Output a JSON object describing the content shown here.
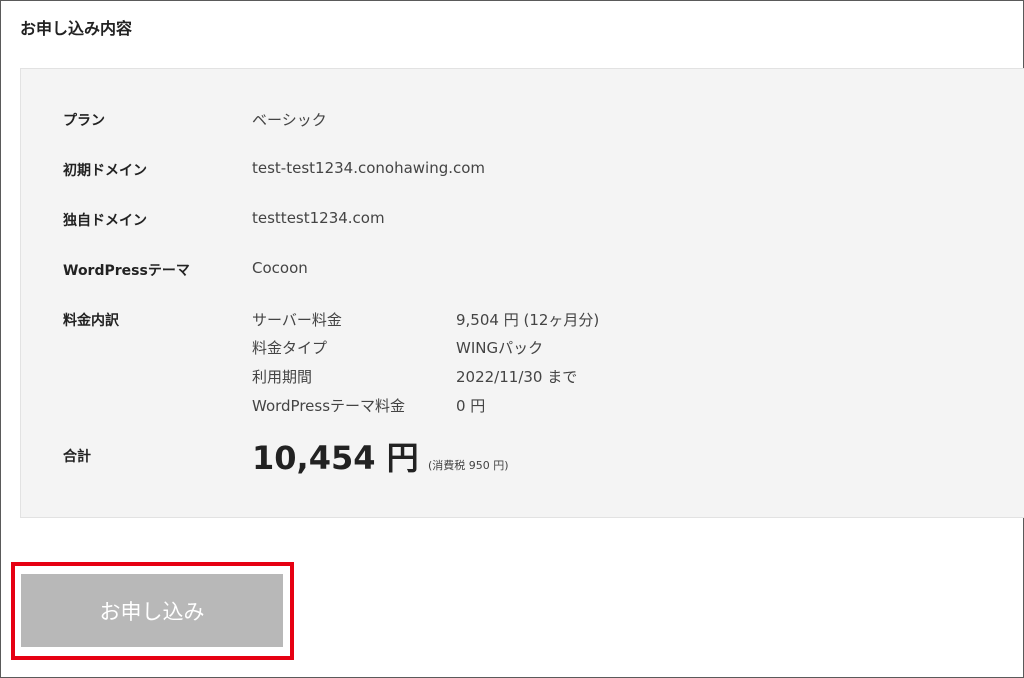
{
  "header": {
    "title": "お申し込み内容"
  },
  "details": {
    "plan": {
      "label": "プラン",
      "value": "ベーシック"
    },
    "initial_domain": {
      "label": "初期ドメイン",
      "value": "test-test1234.conohawing.com"
    },
    "custom_domain": {
      "label": "独自ドメイン",
      "value": "testtest1234.com"
    },
    "wp_theme": {
      "label": "WordPressテーマ",
      "value": "Cocoon"
    },
    "breakdown": {
      "label": "料金内訳",
      "items": [
        {
          "name": "サーバー料金",
          "value": "9,504 円 (12ヶ月分)"
        },
        {
          "name": "料金タイプ",
          "value": "WINGパック"
        },
        {
          "name": "利用期間",
          "value": "2022/11/30 まで"
        },
        {
          "name": "WordPressテーマ料金",
          "value": "0 円"
        }
      ]
    },
    "total": {
      "label": "合計",
      "amount": "10,454 円",
      "tax_note": "(消費税 950 円)"
    }
  },
  "actions": {
    "submit_label": "お申し込み"
  },
  "colors": {
    "panel_bg": "#f4f4f4",
    "button_bg": "#b8b8b8",
    "highlight_border": "#e60012"
  }
}
